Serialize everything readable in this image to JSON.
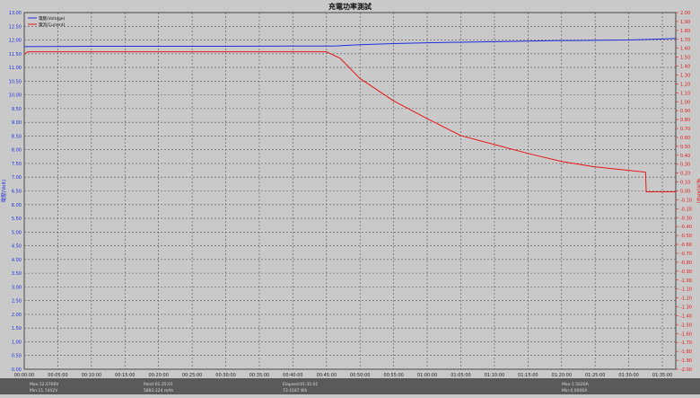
{
  "window": {
    "title": "充電功率測試"
  },
  "legend": [
    {
      "label": "電壓(Voltage)",
      "color": "#1f2fd6"
    },
    {
      "label": "電流(Current)",
      "color": "#e01b1b"
    }
  ],
  "status_bar": [
    {
      "line1": "Max:12.0760V",
      "line2": "Min:11.7442V"
    },
    {
      "line1": "Point:01:35:01",
      "line2": "5883.224 mAh"
    },
    {
      "line1": "Elapsed:01:35:01",
      "line2": "73.4187 Wh"
    },
    {
      "line1": "Max:1.5620A",
      "line2": "Min:0.0000A"
    }
  ],
  "colors": {
    "background": "#c9c9c9",
    "plot_background": "#c9c9c9",
    "grid": "#555555",
    "left_axis": "#1f2fd6",
    "right_axis": "#e01b1b",
    "status_bar": "#5a5a5a"
  },
  "chart_data": {
    "type": "line",
    "title": "充電功率測試",
    "xlabel": "",
    "ylabel_left": "電壓(Volt)",
    "ylabel_right": "電流(Amp)",
    "x_unit": "minutes",
    "xlim": [
      0,
      97
    ],
    "x_ticks": [
      0,
      5,
      10,
      15,
      20,
      25,
      30,
      35,
      40,
      45,
      50,
      55,
      60,
      65,
      70,
      75,
      80,
      85,
      90,
      95
    ],
    "x_tick_labels": [
      "00:00:00",
      "00:05:00",
      "00:10:00",
      "00:15:00",
      "00:20:00",
      "00:25:00",
      "00:30:00",
      "00:35:00",
      "00:40:00",
      "00:45:00",
      "00:50:00",
      "00:55:00",
      "01:00:00",
      "01:05:00",
      "01:10:00",
      "01:15:00",
      "01:20:00",
      "01:25:00",
      "01:30:00",
      "01:35:00"
    ],
    "ylim_left": [
      0,
      13
    ],
    "y_left_ticks": [
      "0.00",
      "0.50",
      "1.00",
      "1.50",
      "2.00",
      "2.50",
      "3.00",
      "3.50",
      "4.00",
      "4.50",
      "5.00",
      "5.50",
      "6.00",
      "6.50",
      "7.00",
      "7.50",
      "8.00",
      "8.50",
      "9.00",
      "9.50",
      "10.00",
      "10.50",
      "11.00",
      "11.50",
      "12.00",
      "12.50",
      "13.00"
    ],
    "ylim_right": [
      -2.0,
      2.0
    ],
    "y_right_ticks": [
      "2.00",
      "1.90",
      "1.80",
      "1.70",
      "1.60",
      "1.50",
      "1.40",
      "1.30",
      "1.20",
      "1.10",
      "1.00",
      "0.90",
      "0.80",
      "0.70",
      "0.60",
      "0.50",
      "0.40",
      "0.30",
      "0.20",
      "0.10",
      "0.00",
      "-0.10",
      "-0.20",
      "-0.30",
      "-0.40",
      "-0.50",
      "-0.60",
      "-0.70",
      "-0.80",
      "-0.90",
      "-1.00",
      "-1.10",
      "-1.20",
      "-1.30",
      "-1.40",
      "-1.50",
      "-1.60",
      "-1.70",
      "-1.80",
      "-1.90",
      "-2.00"
    ],
    "grid": true,
    "legend_position": "top-left",
    "series": [
      {
        "name": "電壓(Voltage)",
        "axis": "left",
        "color": "#1f2fd6",
        "x": [
          0,
          10,
          20,
          30,
          40,
          46,
          50,
          55,
          60,
          65,
          70,
          75,
          80,
          85,
          90,
          95,
          97
        ],
        "y": [
          11.76,
          11.77,
          11.77,
          11.77,
          11.78,
          11.78,
          11.83,
          11.87,
          11.9,
          11.92,
          11.94,
          11.96,
          11.98,
          11.99,
          12.0,
          12.04,
          12.06
        ]
      },
      {
        "name": "電流(Current)",
        "axis": "right",
        "color": "#e01b1b",
        "x": [
          0,
          0.5,
          10,
          20,
          30,
          40,
          45,
          47,
          50,
          55,
          60,
          65,
          70,
          75,
          80,
          85,
          90,
          92.5,
          92.6,
          95,
          97
        ],
        "y": [
          1.53,
          1.56,
          1.56,
          1.56,
          1.56,
          1.56,
          1.56,
          1.49,
          1.26,
          1.01,
          0.81,
          0.62,
          0.52,
          0.42,
          0.33,
          0.27,
          0.23,
          0.21,
          -0.01,
          -0.01,
          -0.01
        ]
      }
    ]
  }
}
